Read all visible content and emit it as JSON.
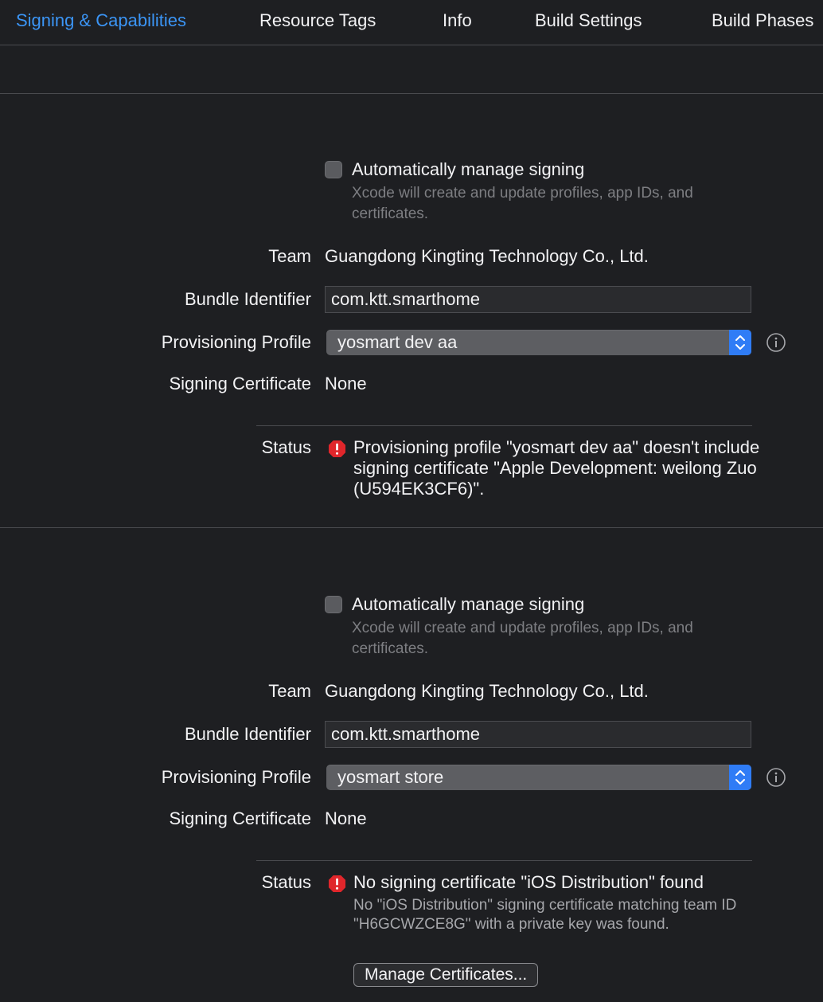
{
  "tabs": [
    {
      "label": "Signing & Capabilities",
      "active": true
    },
    {
      "label": "Resource Tags",
      "active": false
    },
    {
      "label": "Info",
      "active": false
    },
    {
      "label": "Build Settings",
      "active": false
    },
    {
      "label": "Build Phases",
      "active": false
    }
  ],
  "colors": {
    "accent": "#3b95f6",
    "background": "#1e1f22",
    "error": "#e0262b",
    "stepper": "#2f7cf6"
  },
  "sections": [
    {
      "auto_signing_label": "Automatically manage signing",
      "auto_signing_checked": false,
      "auto_signing_help": "Xcode will create and update profiles, app IDs, and certificates.",
      "team_label": "Team",
      "team_value": "Guangdong Kingting Technology Co., Ltd.",
      "bundle_label": "Bundle Identifier",
      "bundle_value": "com.ktt.smarthome",
      "profile_label": "Provisioning Profile",
      "profile_value": "yosmart dev aa",
      "cert_label": "Signing Certificate",
      "cert_value": "None",
      "status_label": "Status",
      "status_icon": "error-icon",
      "status_message": "Provisioning profile \"yosmart dev aa\" doesn't include signing certificate \"Apple Development: weilong Zuo (U594EK3CF6)\".",
      "status_detail": ""
    },
    {
      "auto_signing_label": "Automatically manage signing",
      "auto_signing_checked": false,
      "auto_signing_help": "Xcode will create and update profiles, app IDs, and certificates.",
      "team_label": "Team",
      "team_value": "Guangdong Kingting Technology Co., Ltd.",
      "bundle_label": "Bundle Identifier",
      "bundle_value": "com.ktt.smarthome",
      "profile_label": "Provisioning Profile",
      "profile_value": "yosmart store",
      "cert_label": "Signing Certificate",
      "cert_value": "None",
      "status_label": "Status",
      "status_icon": "error-icon",
      "status_message": "No signing certificate \"iOS Distribution\" found",
      "status_detail": "No \"iOS Distribution\" signing certificate matching team ID \"H6GCWZCE8G\" with a private key was found.",
      "manage_button_label": "Manage Certificates..."
    }
  ]
}
